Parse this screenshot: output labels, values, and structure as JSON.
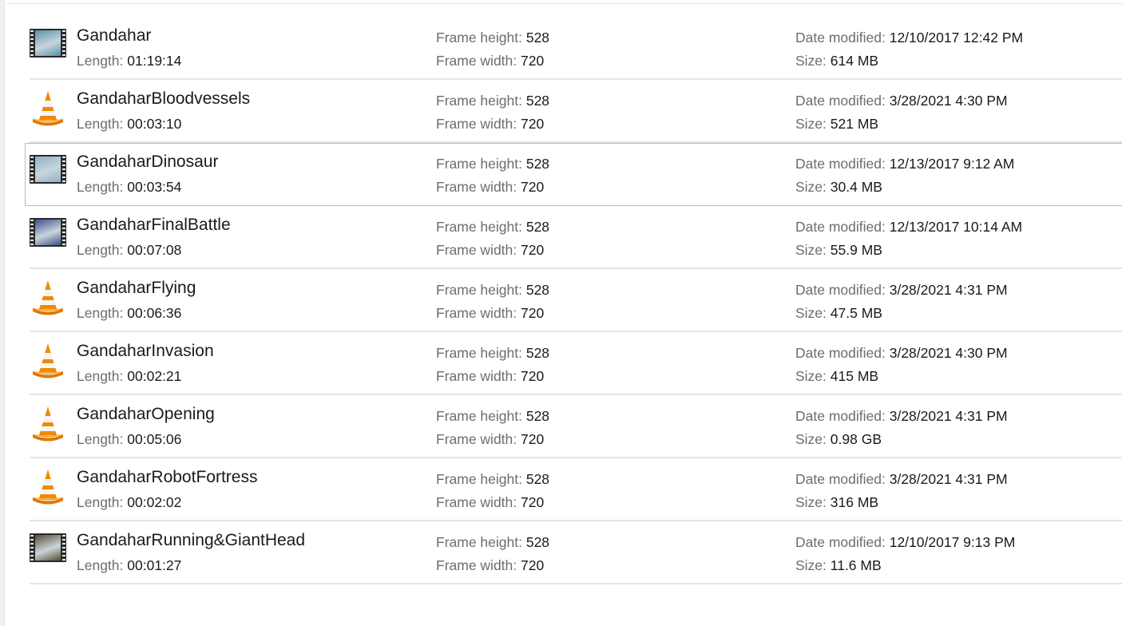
{
  "labels": {
    "length": "Length:",
    "frame_height": "Frame height:",
    "frame_width": "Frame width:",
    "date_modified": "Date modified:",
    "size": "Size:"
  },
  "files": [
    {
      "name": "Gandahar",
      "length": "01:19:14",
      "frame_height": "528",
      "frame_width": "720",
      "date_modified": "12/10/2017 12:42 PM",
      "size": "614 MB",
      "icon": "video-thumbnail-icon"
    },
    {
      "name": "GandaharBloodvessels",
      "length": "00:03:10",
      "frame_height": "528",
      "frame_width": "720",
      "date_modified": "3/28/2021 4:30 PM",
      "size": "521 MB",
      "icon": "vlc-cone-icon"
    },
    {
      "name": "GandaharDinosaur",
      "length": "00:03:54",
      "frame_height": "528",
      "frame_width": "720",
      "date_modified": "12/13/2017 9:12 AM",
      "size": "30.4 MB",
      "icon": "video-thumbnail-icon",
      "selected": true
    },
    {
      "name": "GandaharFinalBattle",
      "length": "00:07:08",
      "frame_height": "528",
      "frame_width": "720",
      "date_modified": "12/13/2017 10:14 AM",
      "size": "55.9 MB",
      "icon": "video-thumbnail-icon"
    },
    {
      "name": "GandaharFlying",
      "length": "00:06:36",
      "frame_height": "528",
      "frame_width": "720",
      "date_modified": "3/28/2021 4:31 PM",
      "size": "47.5 MB",
      "icon": "vlc-cone-icon"
    },
    {
      "name": "GandaharInvasion",
      "length": "00:02:21",
      "frame_height": "528",
      "frame_width": "720",
      "date_modified": "3/28/2021 4:30 PM",
      "size": "415 MB",
      "icon": "vlc-cone-icon"
    },
    {
      "name": "GandaharOpening",
      "length": "00:05:06",
      "frame_height": "528",
      "frame_width": "720",
      "date_modified": "3/28/2021 4:31 PM",
      "size": "0.98 GB",
      "icon": "vlc-cone-icon"
    },
    {
      "name": "GandaharRobotFortress",
      "length": "00:02:02",
      "frame_height": "528",
      "frame_width": "720",
      "date_modified": "3/28/2021 4:31 PM",
      "size": "316 MB",
      "icon": "vlc-cone-icon"
    },
    {
      "name": "GandaharRunning&GiantHead",
      "length": "00:01:27",
      "frame_height": "528",
      "frame_width": "720",
      "date_modified": "12/10/2017 9:13 PM",
      "size": "11.6 MB",
      "icon": "video-thumbnail-icon"
    }
  ],
  "thumb_colors": [
    "#5a8fa8",
    "#8fb0c8",
    "#3d4f8a",
    "#5a4a30"
  ],
  "colors": {
    "cone_orange": "#f08a00",
    "cone_white": "#f5f5f5",
    "selection_border": "#99c2e4",
    "divider": "#e4e4e4"
  }
}
